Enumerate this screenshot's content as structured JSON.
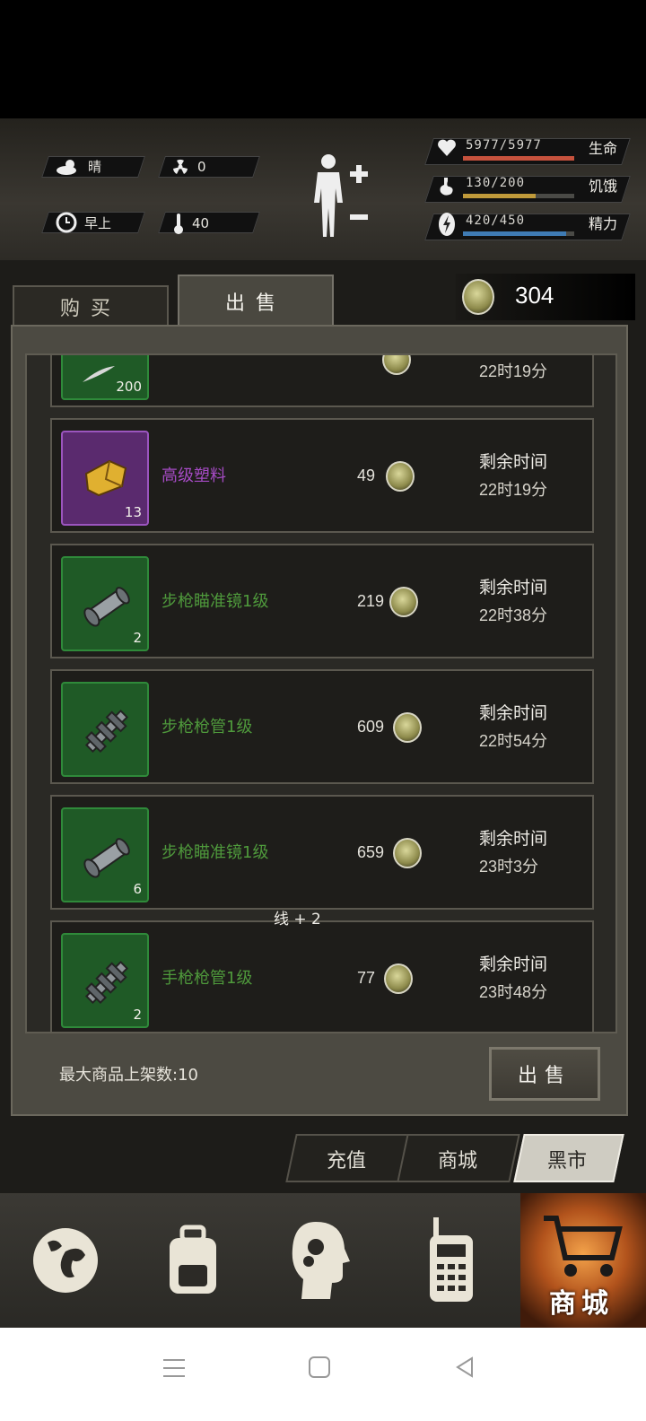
{
  "hud": {
    "weather": "晴",
    "radiation": "0",
    "time_of_day": "早上",
    "temperature": "40",
    "health": {
      "value": "5977/5977",
      "label": "生命",
      "fill": 1.0,
      "color": "#c6523d"
    },
    "hunger": {
      "value": "130/200",
      "label": "饥饿",
      "fill": 0.65,
      "color": "#c09a3a"
    },
    "energy": {
      "value": "420/450",
      "label": "精力",
      "fill": 0.93,
      "color": "#3f7bb4"
    }
  },
  "tabs": {
    "buy": "购买",
    "sell": "出售"
  },
  "currency": "304",
  "items": [
    {
      "name": "",
      "count": "200",
      "price": "",
      "remaining_label": "",
      "remaining_time": "22时19分",
      "rarity": "green"
    },
    {
      "name": "高级塑料",
      "count": "13",
      "price": "49",
      "remaining_label": "剩余时间",
      "remaining_time": "22时19分",
      "rarity": "purple",
      "icon": "plastic-icon"
    },
    {
      "name": "步枪瞄准镜1级",
      "count": "2",
      "price": "219",
      "remaining_label": "剩余时间",
      "remaining_time": "22时38分",
      "rarity": "green",
      "icon": "scope-icon"
    },
    {
      "name": "步枪枪管1级",
      "count": "",
      "price": "609",
      "remaining_label": "剩余时间",
      "remaining_time": "22时54分",
      "rarity": "green",
      "icon": "barrel-icon"
    },
    {
      "name": "步枪瞄准镜1级",
      "count": "6",
      "price": "659",
      "remaining_label": "剩余时间",
      "remaining_time": "23时3分",
      "rarity": "green",
      "icon": "scope-icon"
    },
    {
      "name": "手枪枪管1级",
      "count": "2",
      "price": "77",
      "remaining_label": "剩余时间",
      "remaining_time": "23时48分",
      "rarity": "green",
      "icon": "barrel-icon"
    }
  ],
  "floating_text": "线 + 2",
  "max_listing": "最大商品上架数:10",
  "sell_button": "出售",
  "subtabs": {
    "recharge": "充值",
    "mall": "商城",
    "black_market": "黑市"
  },
  "nav": {
    "shop": "商城"
  },
  "colors": {
    "green_text": "#4f9a3c",
    "purple_text": "#a54bc4",
    "green_slot": "#1f5a26",
    "purple_slot": "#5a2a6e"
  }
}
